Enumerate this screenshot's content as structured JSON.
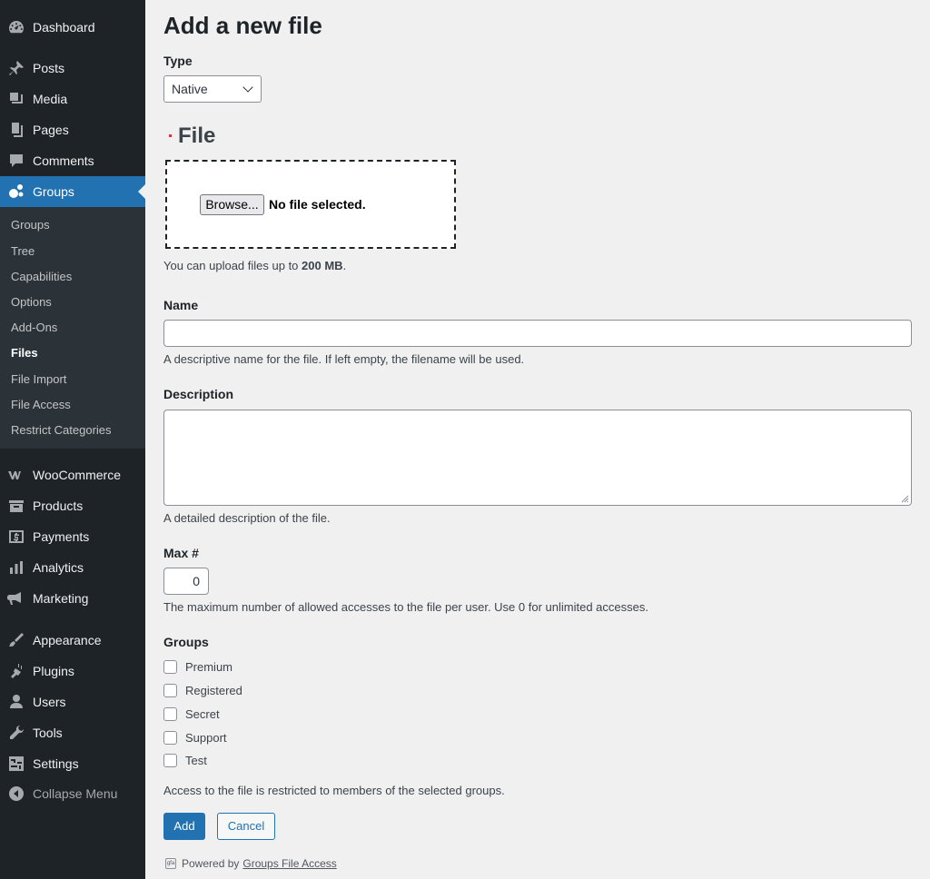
{
  "sidebar": {
    "menu": [
      {
        "label": "Dashboard",
        "icon": "dashboard-icon"
      },
      {
        "label": "Posts",
        "icon": "pin-icon"
      },
      {
        "label": "Media",
        "icon": "media-icon"
      },
      {
        "label": "Pages",
        "icon": "pages-icon"
      },
      {
        "label": "Comments",
        "icon": "comment-icon"
      },
      {
        "label": "Groups",
        "icon": "groups-icon"
      },
      {
        "label": "WooCommerce",
        "icon": "woocommerce-icon"
      },
      {
        "label": "Products",
        "icon": "archive-icon"
      },
      {
        "label": "Payments",
        "icon": "payments-icon"
      },
      {
        "label": "Analytics",
        "icon": "analytics-icon"
      },
      {
        "label": "Marketing",
        "icon": "megaphone-icon"
      },
      {
        "label": "Appearance",
        "icon": "brush-icon"
      },
      {
        "label": "Plugins",
        "icon": "plugin-icon"
      },
      {
        "label": "Users",
        "icon": "user-icon"
      },
      {
        "label": "Tools",
        "icon": "wrench-icon"
      },
      {
        "label": "Settings",
        "icon": "settings-icon"
      }
    ],
    "submenu": [
      "Groups",
      "Tree",
      "Capabilities",
      "Options",
      "Add-Ons",
      "Files",
      "File Import",
      "File Access",
      "Restrict Categories"
    ],
    "collapse_label": "Collapse Menu"
  },
  "page": {
    "title": "Add a new file",
    "type_label": "Type",
    "type_value": "Native",
    "file_heading": "File",
    "browse_label": "Browse...",
    "no_file_text": "No file selected.",
    "upload_help_prefix": "You can upload files up to ",
    "upload_help_size": "200 MB",
    "upload_help_suffix": ".",
    "name_label": "Name",
    "name_value": "",
    "name_help": "A descriptive name for the file. If left empty, the filename will be used.",
    "description_label": "Description",
    "description_value": "",
    "description_help": "A detailed description of the file.",
    "max_label": "Max #",
    "max_value": "0",
    "max_help": "The maximum number of allowed accesses to the file per user. Use 0 for unlimited accesses.",
    "groups_label": "Groups",
    "groups": [
      "Premium",
      "Registered",
      "Secret",
      "Support",
      "Test"
    ],
    "groups_help": "Access to the file is restricted to members of the selected groups.",
    "add_button": "Add",
    "cancel_button": "Cancel",
    "powered_prefix": "Powered by",
    "powered_link": "Groups File Access"
  },
  "colors": {
    "sidebar_bg": "#1d2327",
    "submenu_bg": "#2c3338",
    "accent": "#2271b1",
    "page_bg": "#f0f0f1"
  }
}
